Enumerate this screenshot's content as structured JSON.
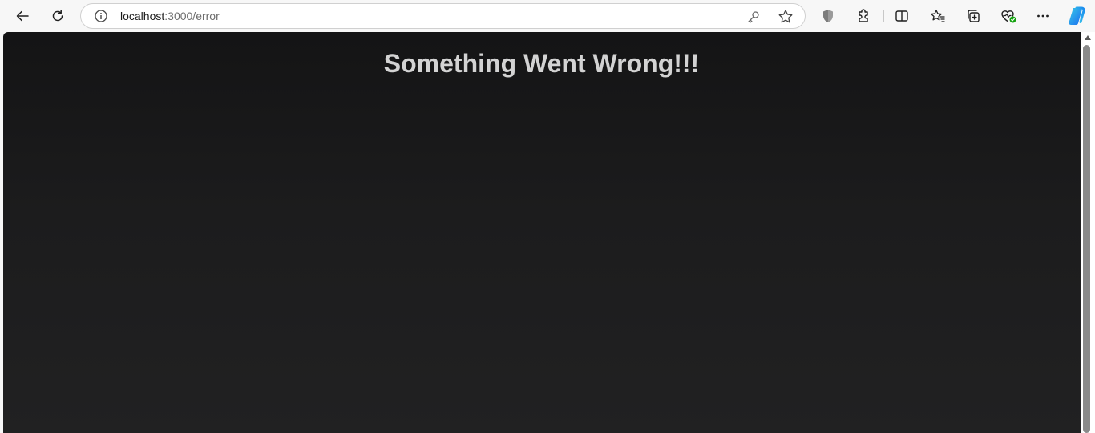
{
  "browser": {
    "address": {
      "host": "localhost",
      "path": ":3000/error"
    },
    "icons": {
      "back": "back-arrow-icon",
      "refresh": "refresh-icon",
      "site_info": "info-icon",
      "password": "key-icon",
      "favorite": "star-icon",
      "shield": "shield-icon",
      "extensions": "puzzle-icon",
      "split_screen": "split-screen-icon",
      "favorites": "favorites-icon",
      "collections": "collections-icon",
      "performance": "heart-pulse-icon",
      "more": "more-icon",
      "copilot": "copilot-icon"
    },
    "colors": {
      "toolbar": "#f7f7f7",
      "performance_badge": "#13a10e",
      "copilot_blue": "#1b8cf0",
      "copilot_teal": "#38c8e8"
    }
  },
  "page": {
    "title": "Something Went Wrong!!!",
    "background_top": "#141415",
    "background_bottom": "#212122",
    "title_color": "#d3d3d3"
  }
}
